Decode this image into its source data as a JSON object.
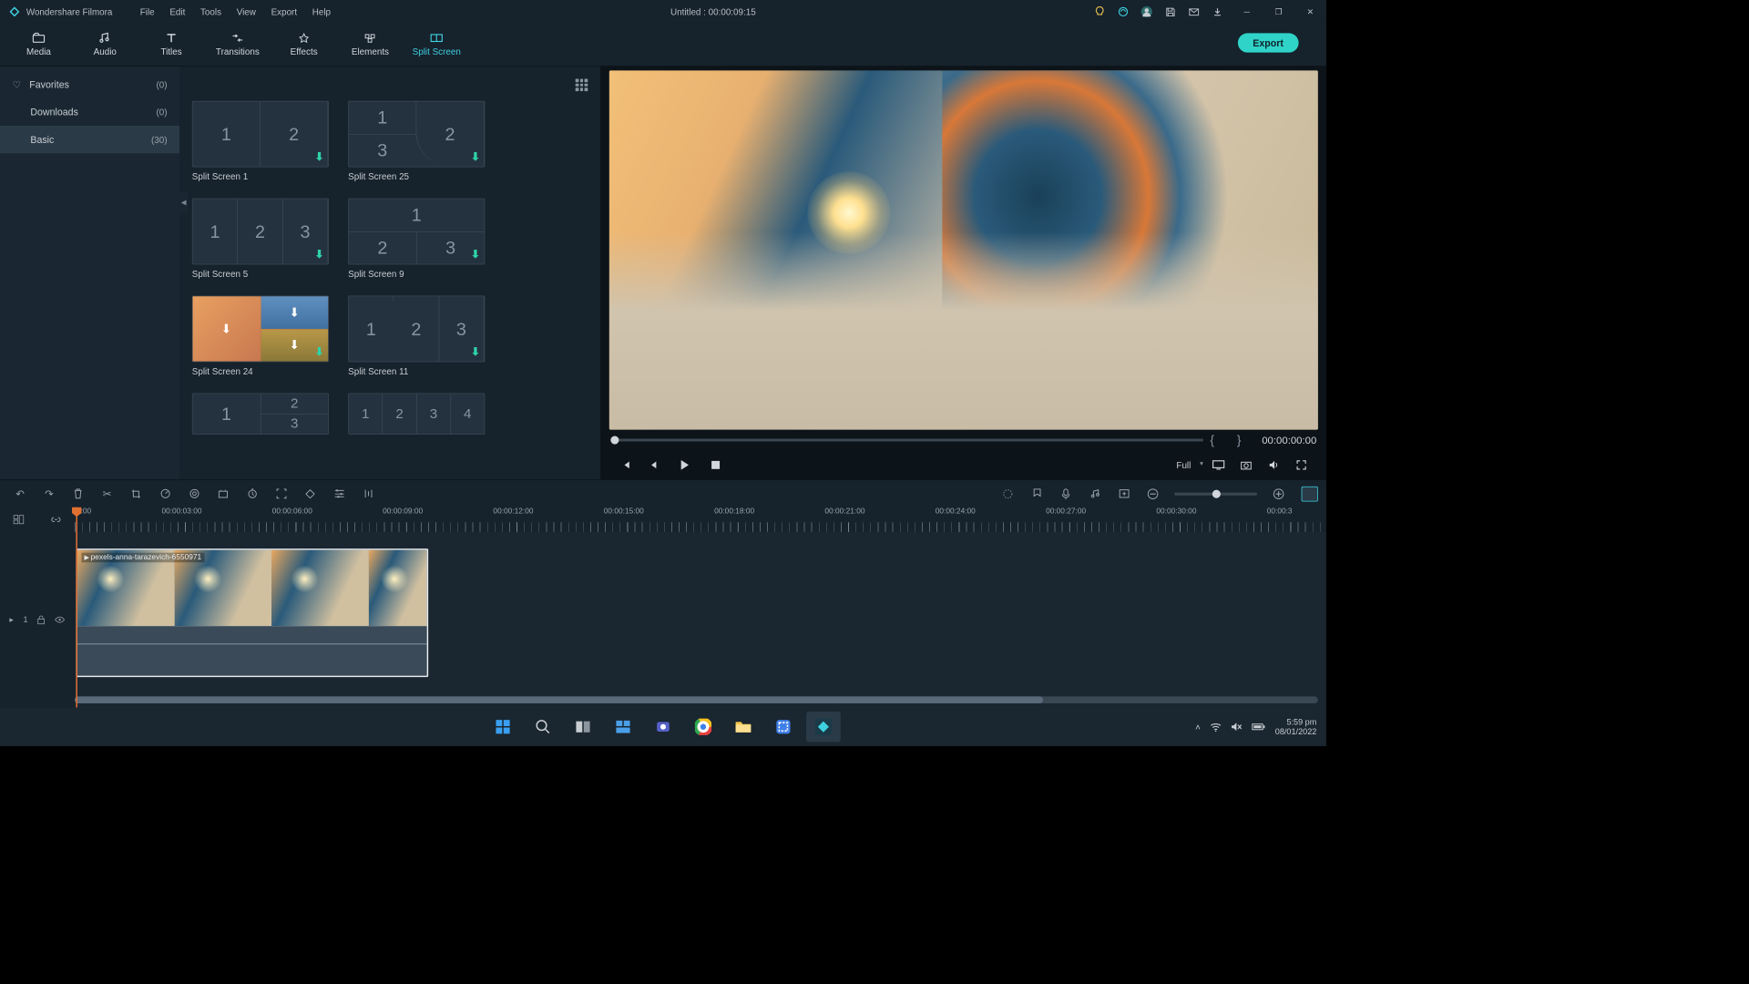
{
  "app": {
    "name": "Wondershare Filmora",
    "project_title": "Untitled : 00:00:09:15"
  },
  "menus": [
    "File",
    "Edit",
    "Tools",
    "View",
    "Export",
    "Help"
  ],
  "tabs": [
    {
      "label": "Media"
    },
    {
      "label": "Audio"
    },
    {
      "label": "Titles"
    },
    {
      "label": "Transitions"
    },
    {
      "label": "Effects"
    },
    {
      "label": "Elements"
    },
    {
      "label": "Split Screen"
    }
  ],
  "active_tab": 6,
  "export_label": "Export",
  "categories": [
    {
      "label": "Favorites",
      "count": "(0)",
      "icon": "heart"
    },
    {
      "label": "Downloads",
      "count": "(0)"
    },
    {
      "label": "Basic",
      "count": "(30)",
      "selected": true
    }
  ],
  "thumbs": [
    {
      "label": "Split Screen 1",
      "layout": "v2",
      "cells": [
        "1",
        "2"
      ]
    },
    {
      "label": "Split Screen 25",
      "layout": "l3",
      "cells": [
        "1",
        "2",
        "3"
      ]
    },
    {
      "label": "Split Screen 5",
      "layout": "v3",
      "cells": [
        "1",
        "2",
        "3"
      ]
    },
    {
      "label": "Split Screen 9",
      "layout": "t3",
      "cells": [
        "1",
        "2",
        "3"
      ]
    },
    {
      "label": "Split Screen 24",
      "layout": "img"
    },
    {
      "label": "Split Screen 11",
      "layout": "d3",
      "cells": [
        "1",
        "2",
        "3"
      ]
    },
    {
      "label": "",
      "layout": "r3",
      "cells": [
        "1",
        "2",
        "3"
      ]
    },
    {
      "label": "",
      "layout": "v4",
      "cells": [
        "1",
        "2",
        "3",
        "4"
      ]
    }
  ],
  "preview": {
    "time": "00:00:00:00",
    "quality": "Full"
  },
  "ruler": [
    "00:00:00:00",
    "00:00:03:00",
    "00:00:06:00",
    "00:00:09:00",
    "00:00:12:00",
    "00:00:15:00",
    "00:00:18:00",
    "00:00:21:00",
    "00:00:24:00",
    "00:00:27:00",
    "00:00:30:00",
    "00:00:3"
  ],
  "clip": {
    "name": "pexels-anna-tarazevich-6550971"
  },
  "track_head": {
    "v": "1"
  },
  "taskbar": {
    "time": "5:59 pm",
    "date": "08/01/2022"
  }
}
